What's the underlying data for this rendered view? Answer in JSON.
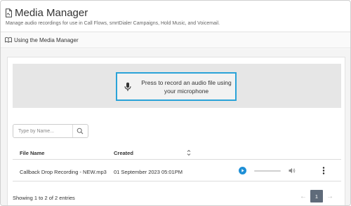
{
  "header": {
    "title": "Media Manager",
    "subtitle": "Manage audio recordings for use in Call Flows, smrtDialer Campaigns, Hold Music, and Voicemail."
  },
  "help": {
    "label": "Using the Media Manager"
  },
  "recorder": {
    "button_label": "Press to record an audio file using your microphone"
  },
  "search": {
    "placeholder": "Type by Name..."
  },
  "table": {
    "columns": [
      "File Name",
      "Created"
    ],
    "rows": [
      {
        "file_name": "Callback Drop Recording - NEW.mp3",
        "created": "01 September 2023 05:01PM"
      }
    ]
  },
  "footer": {
    "entries_text": "Showing 1 to 2 of 2 entries",
    "pagination": {
      "prev": "←",
      "current_page": "1",
      "next": "→"
    }
  },
  "colors": {
    "accent": "#2aa3d8",
    "pager_active": "#5f6b7a"
  },
  "icons": [
    "document-icon",
    "book-icon",
    "microphone-icon",
    "search-icon",
    "sort-icon",
    "play-icon",
    "volume-icon",
    "kebab-menu-icon"
  ]
}
